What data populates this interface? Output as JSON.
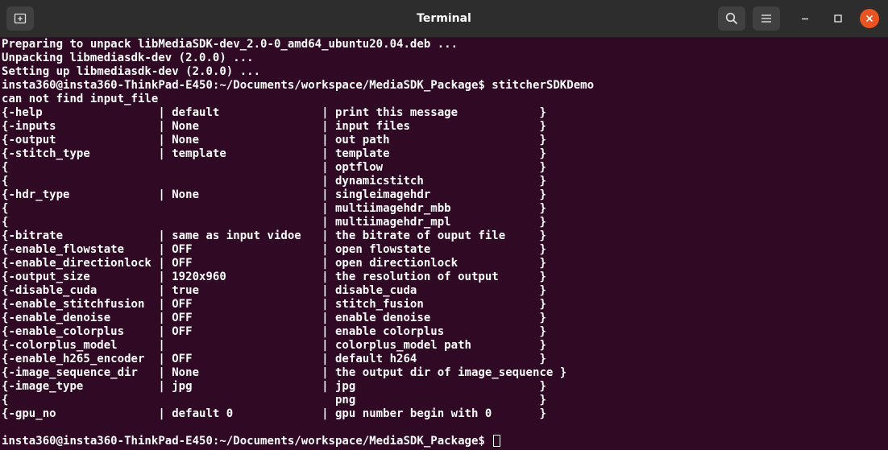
{
  "window": {
    "title": "Terminal"
  },
  "icons": {
    "new_tab": "new-tab-icon",
    "search": "search-icon",
    "menu": "hamburger-menu-icon",
    "minimize": "minimize-icon",
    "maximize": "maximize-icon",
    "close": "close-icon"
  },
  "colors": {
    "background": "#300a24",
    "text": "#ffffff",
    "close_button": "#e95420"
  },
  "terminal": {
    "lines": [
      "Preparing to unpack libMediaSDK-dev_2.0-0_amd64_ubuntu20.04.deb ...",
      "Unpacking libmediasdk-dev (2.0.0) ...",
      "Setting up libmediasdk-dev (2.0.0) ...",
      "insta360@insta360-ThinkPad-E450:~/Documents/workspace/MediaSDK_Package$ stitcherSDKDemo",
      "can not find input_file",
      "{-help                 | default               | print this message            }",
      "{-inputs               | None                  | input files                   }",
      "{-output               | None                  | out path                      }",
      "{-stitch_type          | template              | template                      }",
      "{                                              | optflow                       }",
      "{                                              | dynamicstitch                 }",
      "{-hdr_type             | None                  | singleimagehdr                }",
      "{                                              | multiimagehdr_mbb             }",
      "{                                              | multiimagehdr_mpl             }",
      "{-bitrate              | same as input vidoe   | the bitrate of ouput file     }",
      "{-enable_flowstate     | OFF                   | open flowstate                }",
      "{-enable_directionlock | OFF                   | open directionlock            }",
      "{-output_size          | 1920x960              | the resolution of output      }",
      "{-disable_cuda         | true                  | disable_cuda                  }",
      "{-enable_stitchfusion  | OFF                   | stitch_fusion                 }",
      "{-enable_denoise       | OFF                   | enable denoise                }",
      "{-enable_colorplus     | OFF                   | enable colorplus              }",
      "{-colorplus_model      |                       | colorplus_model path          }",
      "{-enable_h265_encoder  | OFF                   | default h264                  }",
      "{-image_sequence_dir   | None                  | the output dir of image_sequence }",
      "{-image_type           | jpg                   | jpg                           }",
      "{                                                png                           }",
      "{-gpu_no               | default 0             | gpu number begin with 0       }",
      "",
      "insta360@insta360-ThinkPad-E450:~/Documents/workspace/MediaSDK_Package$ "
    ]
  }
}
